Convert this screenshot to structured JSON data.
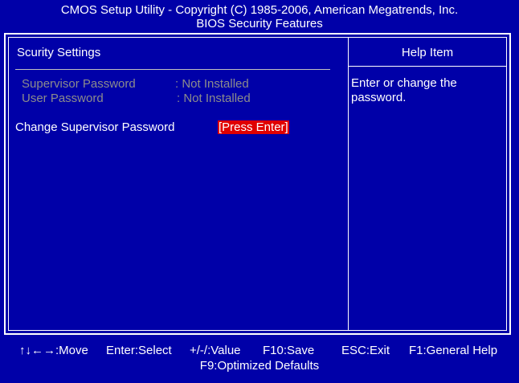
{
  "header": {
    "title": "CMOS Setup Utility - Copyright (C) 1985-2006, American Megatrends, Inc.",
    "subtitle": "BIOS Security Features"
  },
  "left_panel": {
    "section_title": "Scurity Settings",
    "supervisor_password": {
      "label": "Supervisor Password",
      "value": ": Not Installed"
    },
    "user_password": {
      "label": "User Password",
      "value": ": Not Installed"
    },
    "change_supervisor": {
      "label": "Change Supervisor Password",
      "value": "[Press Enter]"
    }
  },
  "help_panel": {
    "title": "Help Item",
    "text": "Enter or change the password."
  },
  "footer": {
    "move": "↑↓←→:Move",
    "enter": "Enter:Select",
    "value": "+/-/:Value",
    "save": "F10:Save",
    "exit": "ESC:Exit",
    "help": "F1:General Help",
    "defaults": "F9:Optimized Defaults"
  },
  "colors": {
    "background": "#0000a8",
    "text": "#ffffff",
    "disabled_text": "#8c8c8c",
    "highlight": "#e00000"
  }
}
